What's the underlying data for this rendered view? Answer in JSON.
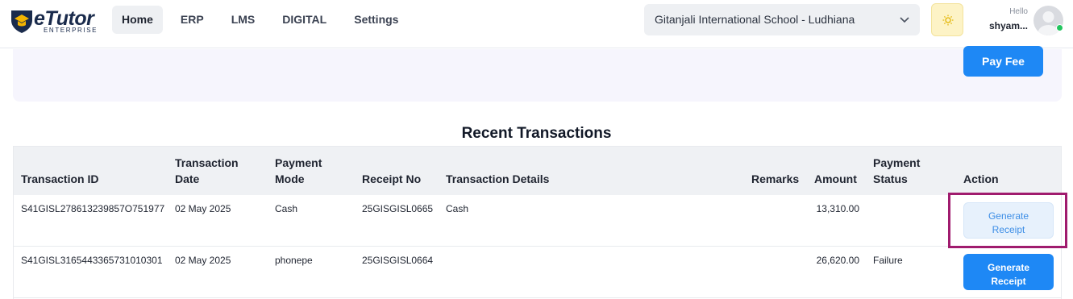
{
  "header": {
    "logo_text": "eTutor",
    "logo_sub": "ENTERPRISE",
    "nav": [
      "Home",
      "ERP",
      "LMS",
      "DIGITAL",
      "Settings"
    ],
    "active_nav": "Home",
    "school_select": "Gitanjali International School - Ludhiana",
    "greeting": "Hello",
    "user_name": "shyam...",
    "icons": [
      "logo-shield-icon",
      "chevron-down-icon",
      "sun-icon",
      "avatar-icon"
    ]
  },
  "fee_card": {
    "pay_button": "Pay Fee"
  },
  "transactions": {
    "title": "Recent Transactions",
    "columns": {
      "id": "Transaction ID",
      "date_1": "Transaction",
      "date_2": "Date",
      "mode_1": "Payment",
      "mode_2": "Mode",
      "receipt": "Receipt No",
      "details": "Transaction Details",
      "remarks": "Remarks",
      "amount": "Amount",
      "status_1": "Payment",
      "status_2": "Status",
      "action": "Action"
    },
    "rows": [
      {
        "id": "S41GISL278613239857O751977",
        "date": "02 May 2025",
        "mode": "Cash",
        "receipt": "25GISGISL0665",
        "details": "Cash",
        "remarks": "",
        "amount": "13,310.00",
        "status": "",
        "action_1": "Generate",
        "action_2": "Receipt"
      },
      {
        "id": "S41GISL3165443365731010301",
        "date": "02 May 2025",
        "mode": "phonepe",
        "receipt": "25GISGISL0664",
        "details": "",
        "remarks": "",
        "amount": "26,620.00",
        "status": "Failure",
        "action_1": "Generate",
        "action_2": "Receipt"
      }
    ]
  },
  "colors": {
    "primary": "#1e88f5",
    "highlight": "#a01b6e",
    "card_bg": "#f6f5fd"
  }
}
